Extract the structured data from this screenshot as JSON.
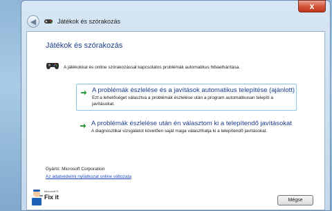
{
  "window": {
    "title": "Játékok és szórakozás",
    "close_glyph": "x"
  },
  "main": {
    "heading": "Játékok és szórakozás",
    "intro": "A játékokkal és online szórakozással kapcsolatos problémák automatikus hibaelhárítása.",
    "intro_icon": "gamepad-icon",
    "options": [
      {
        "title": "A problémák észlelése és a javítások automatikus telepítése (ajánlott)",
        "description": "Ezt a lehetőséget választva a problémák észlelése után a program automatikusan telepíti a javításokat.",
        "icon": "green-arrow-icon"
      },
      {
        "title": "A problémák észlelése után én választom ki a telepítendő javításokat",
        "description": "A diagnosztikai vizsgálatot követően saját maga választhatja ki a telepítendő javításokat.",
        "icon": "green-arrow-icon"
      }
    ]
  },
  "footer": {
    "publisher": "Gyártó: Microsoft Corporation",
    "privacy_link": "Az adatvédelmi nyilatkozat online változata",
    "logo_small": "Microsoft ®",
    "logo_text": "Fix it",
    "close_button": "Mégse"
  },
  "colors": {
    "heading": "#1e3f8c",
    "link": "#1f4fbf",
    "arrow": "#2e9e3a"
  }
}
